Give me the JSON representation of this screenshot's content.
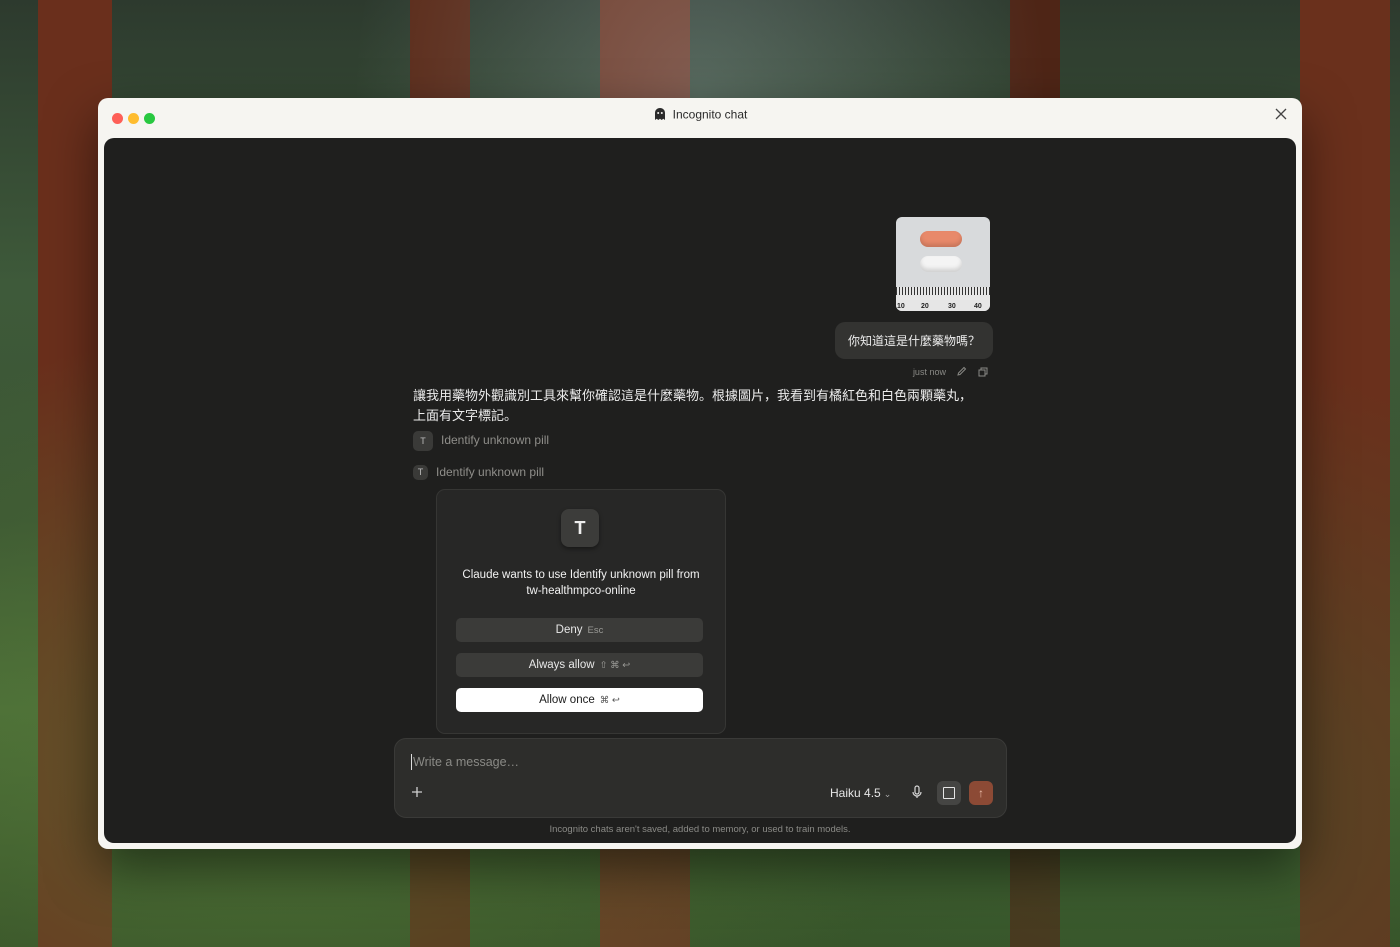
{
  "window": {
    "title": "Incognito chat",
    "title_icon": "ghost-icon"
  },
  "conversation": {
    "user_message": "你知道這是什麼藥物嗎？",
    "user_image_alt": "two pills on a ruler",
    "ruler_marks": [
      "10",
      "20",
      "30",
      "40"
    ],
    "timestamp": "just now",
    "assistant_text": "讓我用藥物外觀識別工具來幫你確認這是什麼藥物。根據圖片，我看到有橘紅色和白色兩顆藥丸，上面有文字標記。",
    "tool_calls": [
      {
        "icon_letter": "T",
        "label": "Identify unknown pill"
      },
      {
        "icon_letter": "T",
        "label": "Identify unknown pill"
      }
    ]
  },
  "permission_card": {
    "icon_letter": "T",
    "message": "Claude wants to use Identify unknown pill from tw-healthmpco-online",
    "deny": {
      "label": "Deny",
      "shortcut": "Esc"
    },
    "always_allow": {
      "label": "Always allow",
      "shortcut": "⇧ ⌘ ↩"
    },
    "allow_once": {
      "label": "Allow once",
      "shortcut": "⌘ ↩"
    }
  },
  "composer": {
    "placeholder": "Write a message…",
    "value": "",
    "model": "Haiku 4.5"
  },
  "disclaimer": "Incognito chats aren't saved, added to memory, or used to train models.",
  "colors": {
    "send_button": "#8c4a35",
    "canvas": "#1f1f1e",
    "window_chrome": "#f6f5f1"
  }
}
